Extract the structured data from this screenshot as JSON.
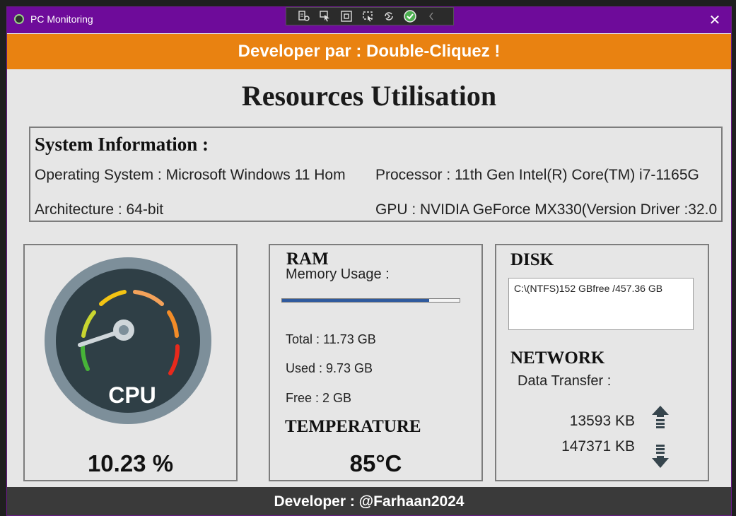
{
  "window": {
    "title": "PC Monitoring",
    "close_glyph": "✕"
  },
  "debug_toolbar": {
    "icons": [
      "live-tree-icon",
      "select-element-icon",
      "display-layout-adorners-icon",
      "track-focus-icon",
      "hot-reload-icon",
      "binding-check-icon",
      "collapse-chevron-icon"
    ]
  },
  "banner": {
    "text": "Developer par : Double-Cliquez !",
    "color": "#e98211"
  },
  "main_title": "Resources Utilisation",
  "system_info": {
    "heading": "System Information :",
    "os": "Operating System : Microsoft Windows 11 Hom",
    "processor": "Processor : 11th Gen Intel(R) Core(TM) i7-1165G",
    "architecture": "Architecture : 64-bit",
    "gpu": "GPU : NVIDIA GeForce MX330(Version Driver :32.0"
  },
  "cpu": {
    "gauge_label": "CPU",
    "usage": "10.23 %"
  },
  "ram": {
    "heading": "RAM",
    "memory_label": "Memory Usage :",
    "usage_fraction": 0.83,
    "total": "Total : 11.73 GB",
    "used": "Used : 9.73 GB",
    "free": "Free : 2 GB"
  },
  "temperature": {
    "heading": "TEMPERATURE",
    "value": "85°C"
  },
  "disk": {
    "heading": "DISK",
    "entry": "C:\\(NTFS)152 GBfree /457.36 GB"
  },
  "network": {
    "heading": "NETWORK",
    "label": "Data Transfer :",
    "upload": "13593 KB",
    "download": "147371 KB"
  },
  "footer": "Developer : @Farhaan2024",
  "colors": {
    "titlebar": "#6e0b9a",
    "accent_orange": "#e98211",
    "progress": "#2f5a9e",
    "footer": "#3a3a3a"
  }
}
